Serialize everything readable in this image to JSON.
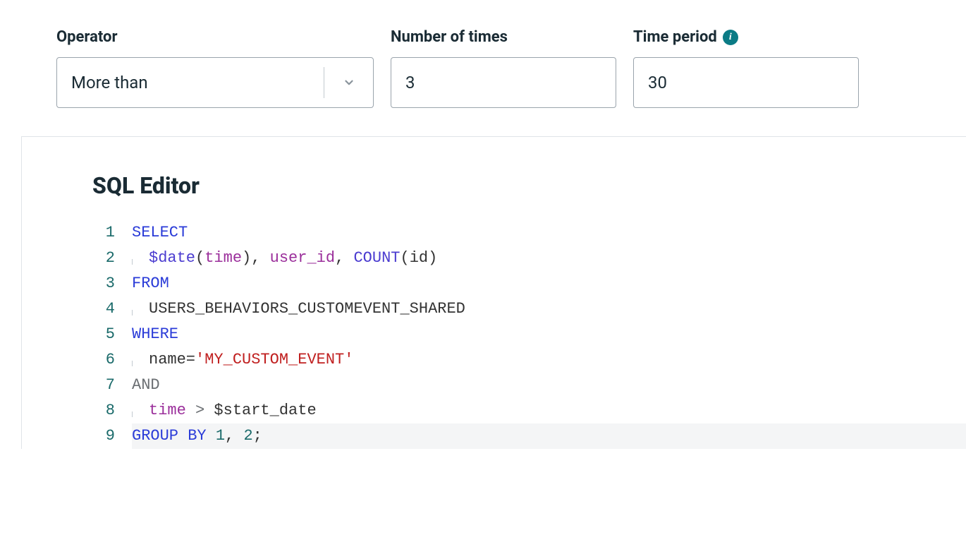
{
  "filters": {
    "operator": {
      "label": "Operator",
      "value": "More than"
    },
    "numberOfTimes": {
      "label": "Number of times",
      "value": "3"
    },
    "timePeriod": {
      "label": "Time period",
      "value": "30"
    }
  },
  "editor": {
    "title": "SQL Editor",
    "lineNumbers": [
      "1",
      "2",
      "3",
      "4",
      "5",
      "6",
      "7",
      "8",
      "9"
    ],
    "tokens": {
      "select": "SELECT",
      "dateFn": "$date",
      "timeArg": "time",
      "userId": "user_id",
      "countFn": "COUNT",
      "idArg": "id",
      "from": "FROM",
      "table": "USERS_BEHAVIORS_CUSTOMEVENT_SHARED",
      "where": "WHERE",
      "nameEq": "name=",
      "eventStr": "'MY_CUSTOM_EVENT'",
      "and": "AND",
      "timeCol": "time",
      "gt": " > ",
      "startDate": "$start_date",
      "groupBy": "GROUP BY",
      "one": "1",
      "comma": ", ",
      "two": "2",
      "semi": ";",
      "paren_open": "(",
      "paren_close": ")",
      "comma_sp": ", "
    }
  }
}
